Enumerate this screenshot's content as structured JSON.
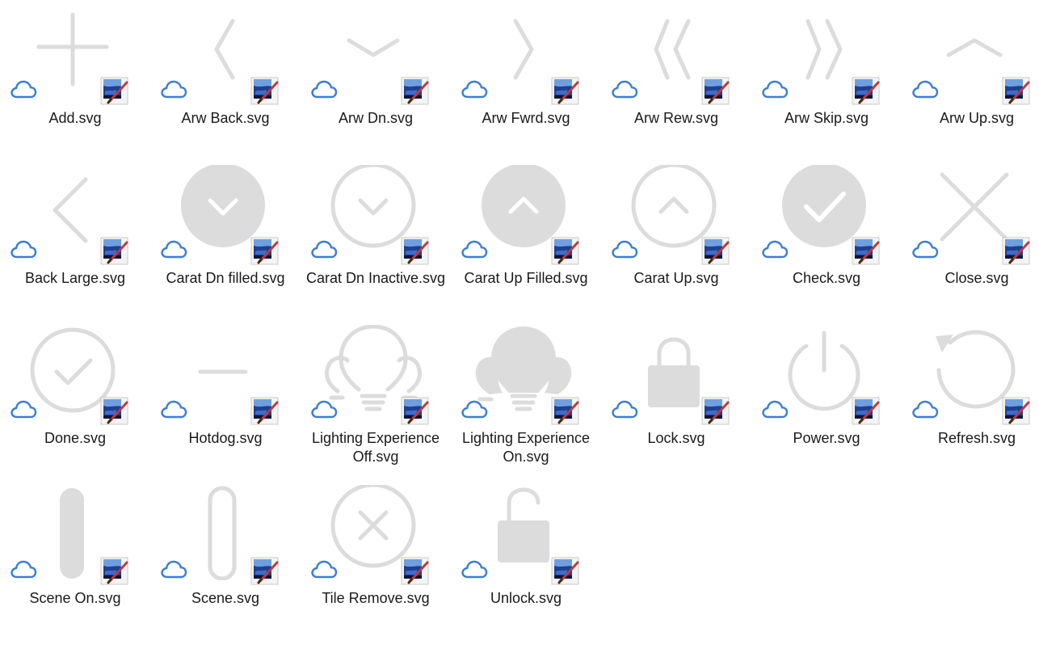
{
  "files": [
    {
      "name": "Add.svg",
      "icon": "add-icon"
    },
    {
      "name": "Arw Back.svg",
      "icon": "arrow-back-icon"
    },
    {
      "name": "Arw Dn.svg",
      "icon": "arrow-down-icon"
    },
    {
      "name": "Arw Fwrd.svg",
      "icon": "arrow-forward-icon"
    },
    {
      "name": "Arw Rew.svg",
      "icon": "arrow-rewind-icon"
    },
    {
      "name": "Arw Skip.svg",
      "icon": "arrow-skip-icon"
    },
    {
      "name": "Arw Up.svg",
      "icon": "arrow-up-icon"
    },
    {
      "name": "Back Large.svg",
      "icon": "back-large-icon"
    },
    {
      "name": "Carat Dn filled.svg",
      "icon": "caret-down-filled-icon"
    },
    {
      "name": "Carat Dn Inactive.svg",
      "icon": "caret-down-inactive-icon"
    },
    {
      "name": "Carat Up Filled.svg",
      "icon": "caret-up-filled-icon"
    },
    {
      "name": "Carat Up.svg",
      "icon": "caret-up-icon"
    },
    {
      "name": "Check.svg",
      "icon": "check-icon"
    },
    {
      "name": "Close.svg",
      "icon": "close-icon"
    },
    {
      "name": "Done.svg",
      "icon": "done-icon"
    },
    {
      "name": "Hotdog.svg",
      "icon": "hotdog-icon"
    },
    {
      "name": "Lighting Experience Off.svg",
      "icon": "lighting-off-icon"
    },
    {
      "name": "Lighting Experience On.svg",
      "icon": "lighting-on-icon"
    },
    {
      "name": "Lock.svg",
      "icon": "lock-icon"
    },
    {
      "name": "Power.svg",
      "icon": "power-icon"
    },
    {
      "name": "Refresh.svg",
      "icon": "refresh-icon"
    },
    {
      "name": "Scene On.svg",
      "icon": "scene-on-icon"
    },
    {
      "name": "Scene.svg",
      "icon": "scene-icon"
    },
    {
      "name": "Tile Remove.svg",
      "icon": "tile-remove-icon"
    },
    {
      "name": "Unlock.svg",
      "icon": "unlock-icon"
    }
  ],
  "status_icon": "cloud-icon",
  "app_icon": "paint-app-icon",
  "colors": {
    "glyph": "#dcdcdc",
    "cloud": "#3c7dd6",
    "text": "#1a1a1a",
    "background": "#ffffff"
  }
}
